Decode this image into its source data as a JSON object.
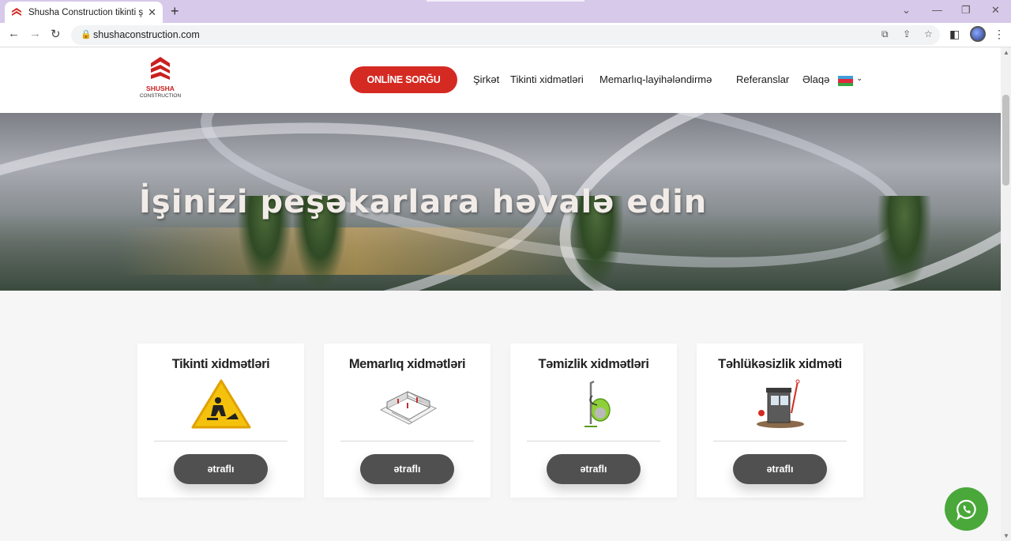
{
  "browser": {
    "tab_title": "Shusha Construction tikinti şirkəti",
    "tab_close": "✕",
    "new_tab": "+",
    "url": "shushaconstruction.com",
    "window_controls": [
      "⌄",
      "—",
      "❐",
      "✕"
    ]
  },
  "header": {
    "logo_brand": "SHUSHA",
    "logo_sub": "CONSTRUCTION",
    "online_button": "ONLİNE SORĞU",
    "nav": [
      "Şirkət",
      "Tikinti xidmətləri",
      "Memarlıq-layihələndirmə",
      "Referanslar",
      "Əlaqə"
    ],
    "flag_colors": [
      "#3f9fd9",
      "#e3273c",
      "#3aa442"
    ]
  },
  "hero": {
    "title": "İşinizi peşəkarlara həvalə edin"
  },
  "cards": [
    {
      "title": "Tikinti xidmətləri",
      "button": "ətraflı",
      "icon": "construction-sign-icon"
    },
    {
      "title": "Memarlıq xidmətləri",
      "button": "ətraflı",
      "icon": "floor-plan-icon"
    },
    {
      "title": "Təmizlik xidmətləri",
      "button": "ətraflı",
      "icon": "vacuum-cleaner-icon"
    },
    {
      "title": "Təhlükəsizlik xidməti",
      "button": "ətraflı",
      "icon": "security-booth-icon"
    }
  ],
  "colors": {
    "accent": "#d42a22",
    "button_dark": "#505050",
    "whatsapp": "#4aa83a"
  }
}
